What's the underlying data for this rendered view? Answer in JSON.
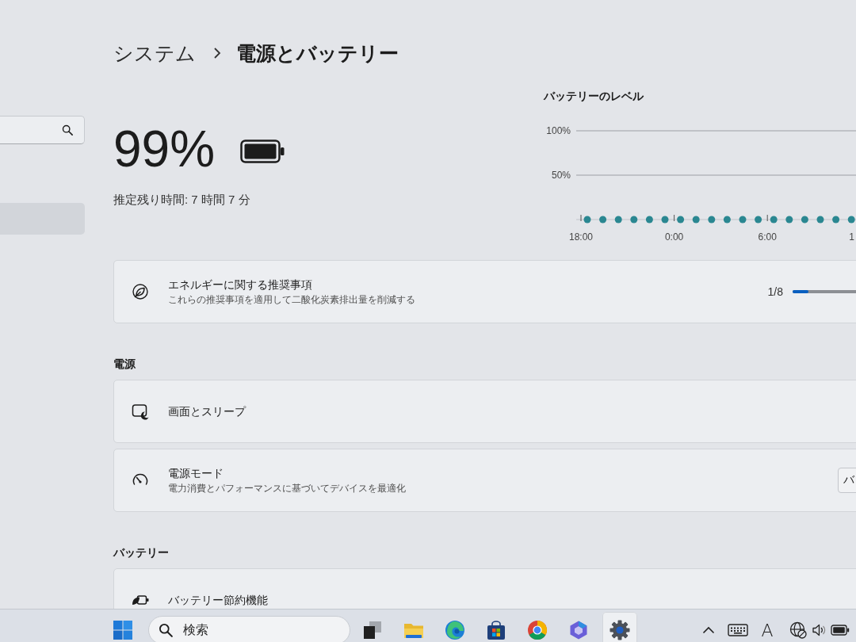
{
  "sidebar": {
    "items": [
      {
        "selected": true
      }
    ]
  },
  "breadcrumb": {
    "parent": "システム",
    "current": "電源とバッテリー"
  },
  "battery": {
    "percent": "99%",
    "estimate": "推定残り時間: 7 時間 7 分"
  },
  "battery_chart": {
    "chart_data": {
      "type": "scatter",
      "title": "バッテリーのレベル",
      "categories": [
        "18:00",
        null,
        null,
        null,
        null,
        null,
        "0:00",
        null,
        null,
        null,
        null,
        null,
        "6:00",
        null,
        null,
        null,
        null,
        null,
        "1"
      ],
      "values": [
        0,
        0,
        0,
        0,
        0,
        0,
        0,
        0,
        0,
        0,
        0,
        0,
        0,
        0,
        0,
        0,
        0,
        0,
        null
      ],
      "ylim": [
        0,
        100
      ],
      "yticks": [
        {
          "value": 50,
          "label": "50%"
        },
        {
          "value": 100,
          "label": "100%"
        }
      ]
    }
  },
  "recommendations": {
    "title": "エネルギーに関する推奨事項",
    "description": "これらの推奨事項を適用して二酸化炭素排出量を削減する",
    "count": "1/8",
    "level": 0.125
  },
  "sections": [
    {
      "heading": "電源",
      "items": [
        {
          "kind": "link",
          "title": "画面とスリープ"
        },
        {
          "kind": "dropdown",
          "title": "電源モード",
          "description": "電力消費とパフォーマンスに基づいてデバイスを最適化",
          "value": "バ"
        }
      ]
    },
    {
      "heading": "バッテリー",
      "items": [
        {
          "kind": "link",
          "title": "バッテリー節約機能"
        }
      ]
    }
  ],
  "taskbar": {
    "search": {
      "placeholder": "検索"
    },
    "apps": [
      {
        "kind": "taskview",
        "selected": false
      },
      {
        "kind": "folder",
        "selected": false
      },
      {
        "kind": "wave",
        "selected": false
      },
      {
        "kind": "bag",
        "selected": false
      },
      {
        "kind": "ring",
        "selected": false
      },
      {
        "kind": "hexagon",
        "selected": false
      },
      {
        "kind": "gear",
        "selected": true
      }
    ],
    "tray": {
      "input_mode": "A"
    }
  }
}
